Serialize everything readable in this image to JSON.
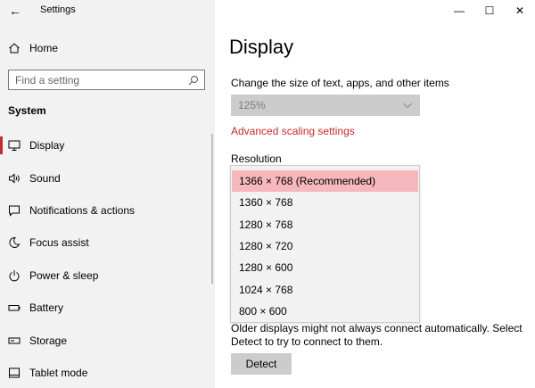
{
  "window": {
    "app_title": "Settings",
    "controls": {
      "minimize": "—",
      "maximize": "☐",
      "close": "✕"
    }
  },
  "sidebar": {
    "back_glyph": "←",
    "home_label": "Home",
    "search_placeholder": "Find a setting",
    "section": "System",
    "active_item": "Display",
    "items": [
      {
        "label": "Display",
        "icon": "monitor-icon"
      },
      {
        "label": "Sound",
        "icon": "speaker-icon"
      },
      {
        "label": "Notifications & actions",
        "icon": "notification-icon"
      },
      {
        "label": "Focus assist",
        "icon": "moon-icon"
      },
      {
        "label": "Power & sleep",
        "icon": "power-icon"
      },
      {
        "label": "Battery",
        "icon": "battery-icon"
      },
      {
        "label": "Storage",
        "icon": "storage-icon"
      },
      {
        "label": "Tablet mode",
        "icon": "tablet-icon"
      }
    ]
  },
  "main": {
    "title": "Display",
    "scale_label": "Change the size of text, apps, and other items",
    "scale_value": "125%",
    "advanced_link": "Advanced scaling settings",
    "resolution_label": "Resolution",
    "resolution_options": [
      "1366 × 768 (Recommended)",
      "1360 × 768",
      "1280 × 768",
      "1280 × 720",
      "1280 × 600",
      "1024 × 768",
      "800 × 600"
    ],
    "resolution_selected": "1366 × 768 (Recommended)",
    "description": "Older displays might not always connect automatically. Select Detect to try to connect to them.",
    "detect_button": "Detect"
  },
  "colors": {
    "accent": "#c42b2b",
    "selected_option_bg": "#f6b8bd",
    "sidebar_bg": "#f2f2f2",
    "disabled_control_bg": "#cccccc"
  }
}
